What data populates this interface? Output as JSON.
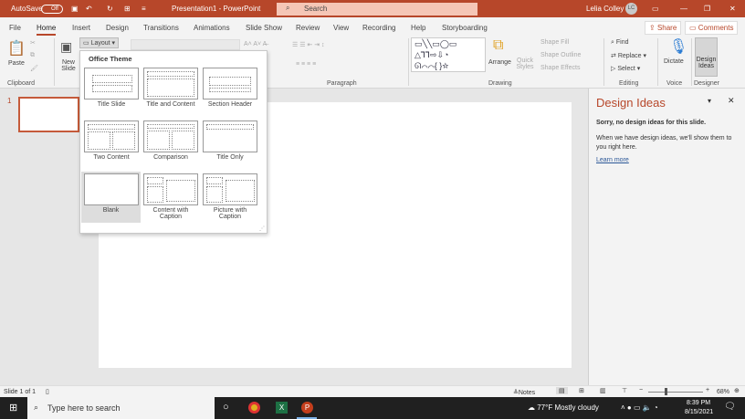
{
  "titlebar": {
    "autosave": "AutoSave",
    "autosave_state": "Off",
    "title": "Presentation1 - PowerPoint",
    "search": "Search",
    "user": "Lelia Colley",
    "initials": "LC"
  },
  "tabs": [
    "File",
    "Home",
    "Insert",
    "Design",
    "Transitions",
    "Animations",
    "Slide Show",
    "Review",
    "View",
    "Recording",
    "Help",
    "Storyboarding"
  ],
  "share": "Share",
  "comments": "Comments",
  "ribbon": {
    "paste": "Paste",
    "new_slide": "New Slide",
    "layout": "Layout",
    "arrange": "Arrange",
    "quick_styles": "Quick Styles",
    "shape_fill": "Shape Fill",
    "shape_outline": "Shape Outline",
    "shape_effects": "Shape Effects",
    "find": "Find",
    "replace": "Replace",
    "select": "Select",
    "dictate": "Dictate",
    "design_ideas": "Design Ideas",
    "groups": [
      "Clipboard",
      "Paragraph",
      "Drawing",
      "Editing",
      "Voice",
      "Designer"
    ]
  },
  "layout_menu": {
    "heading": "Office Theme",
    "items": [
      "Title Slide",
      "Title and Content",
      "Section Header",
      "Two Content",
      "Comparison",
      "Title Only",
      "Blank",
      "Content with Caption",
      "Picture with Caption"
    ],
    "selected": "Blank"
  },
  "slide_number": "1",
  "design_panel": {
    "title": "Design Ideas",
    "heading": "Sorry, no design ideas for this slide.",
    "body": "When we have design ideas, we'll show them to you right here.",
    "link": "Learn more"
  },
  "status": {
    "slide": "Slide 1 of 1",
    "notes": "Notes",
    "zoom": "68%",
    "zoom_percent": 68
  },
  "taskbar": {
    "search": "Type here to search",
    "weather": "77°F  Mostly cloudy",
    "time": "8:39 PM",
    "date": "8/15/2021",
    "notif": "1"
  },
  "colors": {
    "accent": "#b7472a"
  }
}
